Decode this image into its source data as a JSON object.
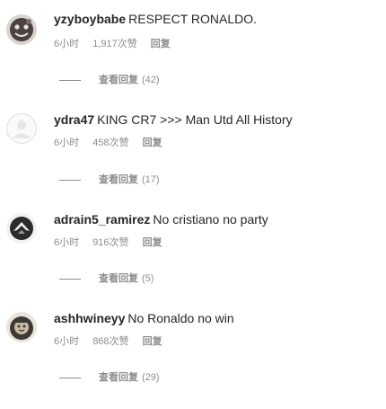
{
  "comments": [
    {
      "username": "yzyboybabe",
      "text": "RESPECT RONALDO.",
      "time": "6小时",
      "likes": "1,917次赞",
      "reply_label": "回复",
      "view_replies_label": "查看回复",
      "view_replies_count": "(42)",
      "avatar": "dark-emoji-avatar"
    },
    {
      "username": "ydra47",
      "text": "KING CR7 >>> Man Utd All History",
      "time": "6小时",
      "likes": "458次赞",
      "reply_label": "回复",
      "view_replies_label": "查看回复",
      "view_replies_count": "(17)",
      "avatar": "default-profile-avatar"
    },
    {
      "username": "adrain5_ramirez",
      "text": "No cristiano no party",
      "time": "6小时",
      "likes": "916次赞",
      "reply_label": "回复",
      "view_replies_label": "查看回复",
      "view_replies_count": "(5)",
      "avatar": "bird-logo-avatar"
    },
    {
      "username": "ashhwineyy",
      "text": "No Ronaldo no win",
      "time": "6小时",
      "likes": "868次赞",
      "reply_label": "回复",
      "view_replies_label": "查看回复",
      "view_replies_count": "(29)",
      "avatar": "character-avatar"
    }
  ]
}
